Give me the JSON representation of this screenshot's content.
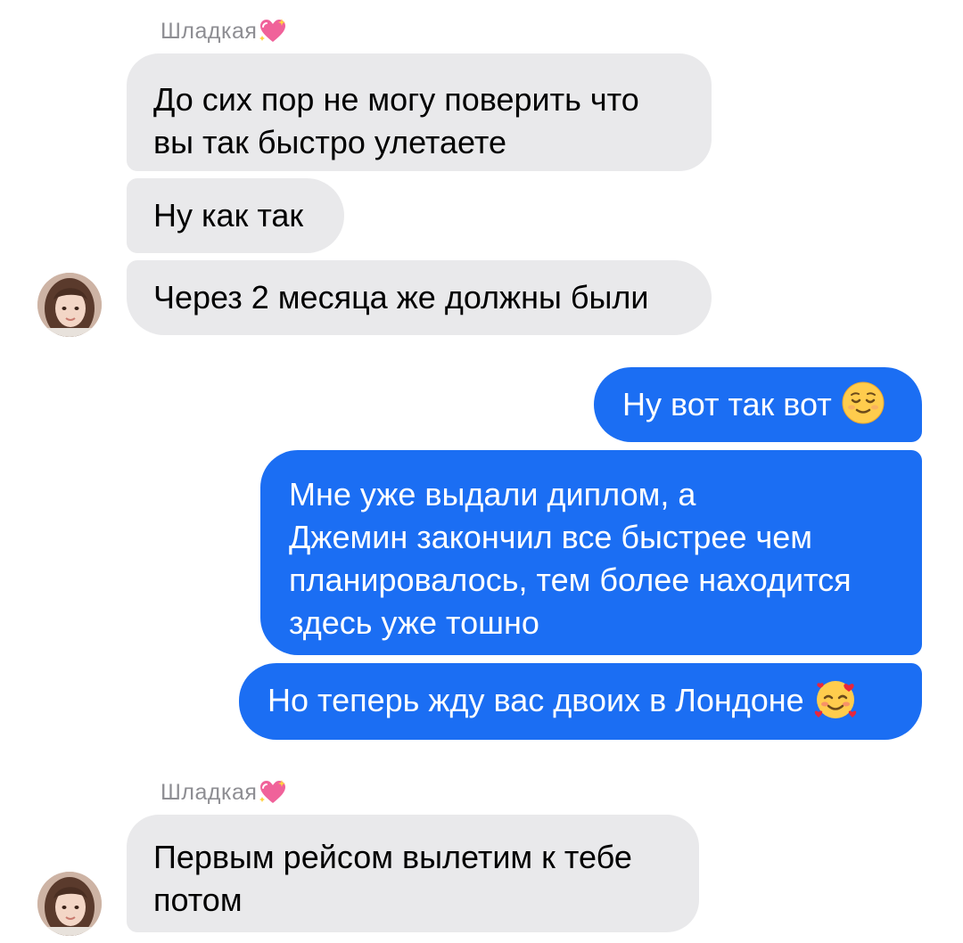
{
  "chat": {
    "groups": [
      {
        "sender": "Шладкая",
        "messages": [
          {
            "lines": [
              "До сих пор не могу поверить что",
              "вы так быстро улетаете"
            ]
          },
          {
            "lines": [
              "Ну как так"
            ]
          },
          {
            "lines": [
              "Через 2 месяца же должны были"
            ]
          }
        ]
      },
      {
        "sender": "me",
        "messages": [
          {
            "text": "Ну вот так вот",
            "emoji": "relieved-face-emoji"
          },
          {
            "lines": [
              "Мне уже выдали диплом, а",
              "Джемин закончил все быстрее чем",
              "планировалось, тем более находится",
              "здесь уже тошно"
            ]
          },
          {
            "text": "Но теперь жду вас двоих в Лондоне",
            "emoji": "smiling-face-with-hearts-emoji"
          }
        ]
      },
      {
        "sender": "Шладкая",
        "messages": [
          {
            "lines": [
              "Первым рейсом вылетим к тебе",
              "потом"
            ]
          }
        ]
      }
    ]
  },
  "colors": {
    "incoming_bubble": "#e9e9eb",
    "outgoing_bubble": "#1b6ef3",
    "sender_name": "#8e8e93"
  },
  "icons": {
    "sender_badge": "sparkling-heart-icon",
    "avatar": "contact-avatar"
  }
}
